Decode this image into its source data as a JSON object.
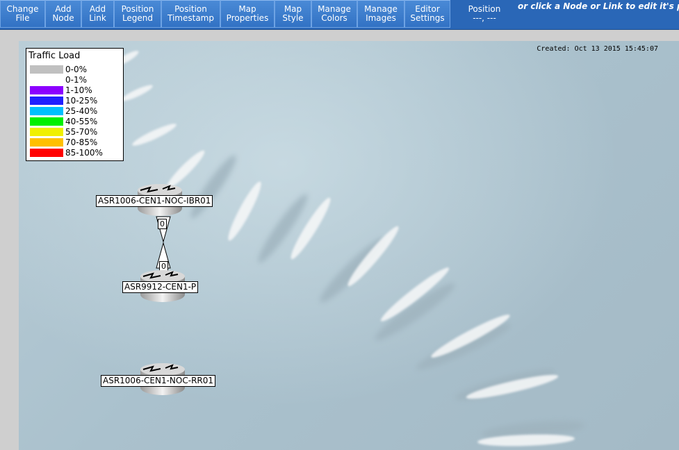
{
  "toolbar": {
    "buttons": [
      {
        "id": "change-file",
        "line1": "Change",
        "line2": "File"
      },
      {
        "id": "add-node",
        "line1": "Add",
        "line2": "Node"
      },
      {
        "id": "add-link",
        "line1": "Add",
        "line2": "Link"
      },
      {
        "id": "position-legend",
        "line1": "Position",
        "line2": "Legend"
      },
      {
        "id": "position-timestamp",
        "line1": "Position",
        "line2": "Timestamp"
      },
      {
        "id": "map-properties",
        "line1": "Map",
        "line2": "Properties"
      },
      {
        "id": "map-style",
        "line1": "Map",
        "line2": "Style"
      },
      {
        "id": "manage-colors",
        "line1": "Manage",
        "line2": "Colors"
      },
      {
        "id": "manage-images",
        "line1": "Manage",
        "line2": "Images"
      },
      {
        "id": "editor-settings",
        "line1": "Editor",
        "line2": "Settings"
      }
    ],
    "position": {
      "label": "Position",
      "value": "---, ---"
    },
    "hint": "or click a Node or Link to edit it's properti"
  },
  "map": {
    "created": "Created: Oct 13 2015 15:45:07",
    "legend": {
      "title": "Traffic Load",
      "items": [
        {
          "label": "0-0%",
          "color": "#c0c0c0"
        },
        {
          "label": "0-1%",
          "color": "#ffffff"
        },
        {
          "label": "1-10%",
          "color": "#8c00ff"
        },
        {
          "label": "10-25%",
          "color": "#2020ff"
        },
        {
          "label": "25-40%",
          "color": "#00c0ff"
        },
        {
          "label": "40-55%",
          "color": "#00f000"
        },
        {
          "label": "55-70%",
          "color": "#f0f000"
        },
        {
          "label": "70-85%",
          "color": "#ffc000"
        },
        {
          "label": "85-100%",
          "color": "#ff0000"
        }
      ]
    },
    "nodes": [
      {
        "name": "ASR1006-CEN1-NOC-IBR01",
        "icon": "router-icon"
      },
      {
        "name": "ASR9912-CEN1-P",
        "icon": "router-icon"
      },
      {
        "name": "ASR1006-CEN1-NOC-RR01",
        "icon": "router-icon"
      }
    ],
    "links": [
      {
        "from": "ASR1006-CEN1-NOC-IBR01",
        "to": "ASR9912-CEN1-P",
        "in_label": "0",
        "out_label": "0"
      }
    ]
  }
}
